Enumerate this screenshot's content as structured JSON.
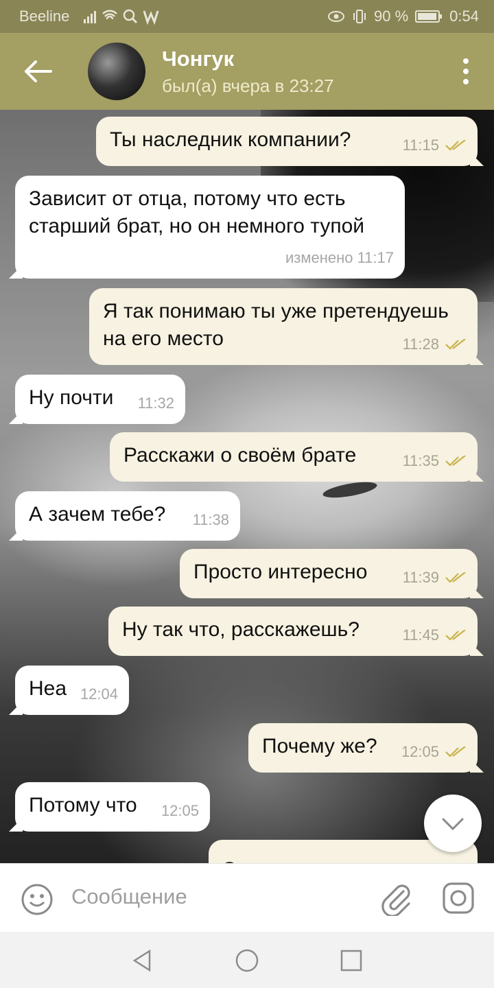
{
  "status_bar": {
    "carrier": "Beeline",
    "battery": "90 %",
    "time": "0:54"
  },
  "header": {
    "contact_name": "Чонгук",
    "last_seen": "был(а) вчера в 23:27"
  },
  "messages": [
    {
      "dir": "out",
      "text": "Ты наследник компании?",
      "time": "11:15",
      "read": true
    },
    {
      "dir": "in",
      "text": "Зависит от отца, потому что есть старший брат, но он немного тупой",
      "time": "изменено 11:17"
    },
    {
      "dir": "out",
      "text": "Я так понимаю ты уже претендуешь на его место",
      "time": "11:28",
      "read": true
    },
    {
      "dir": "in",
      "text": "Ну почти",
      "time": "11:32"
    },
    {
      "dir": "out",
      "text": "Расскажи о своём брате",
      "time": "11:35",
      "read": true
    },
    {
      "dir": "in",
      "text": "А зачем тебе?",
      "time": "11:38"
    },
    {
      "dir": "out",
      "text": "Просто интересно",
      "time": "11:39",
      "read": true
    },
    {
      "dir": "out",
      "text": "Ну так что, расскажешь?",
      "time": "11:45",
      "read": true
    },
    {
      "dir": "in",
      "text": "Неа",
      "time": "12:04"
    },
    {
      "dir": "out",
      "text": "Почему же?",
      "time": "12:05",
      "read": true
    },
    {
      "dir": "in",
      "text": "Потому что",
      "time": "12:05"
    },
    {
      "dir": "out",
      "text": "Это не причина",
      "time": "",
      "read": false
    }
  ],
  "composer": {
    "placeholder": "Сообщение"
  },
  "icons": {
    "back": "arrow-left-icon",
    "menu": "more-vertical-icon",
    "scroll_down": "chevron-down-icon",
    "emoji": "smiley-icon",
    "attach": "paperclip-icon",
    "camera": "camera-icon",
    "read_receipt": "double-check-icon"
  },
  "colors": {
    "header": "#a49f62",
    "status_bar": "#8a8555",
    "outgoing_bubble": "#f7f2e1",
    "incoming_bubble": "#ffffff",
    "check_mark": "#c9b24a"
  }
}
